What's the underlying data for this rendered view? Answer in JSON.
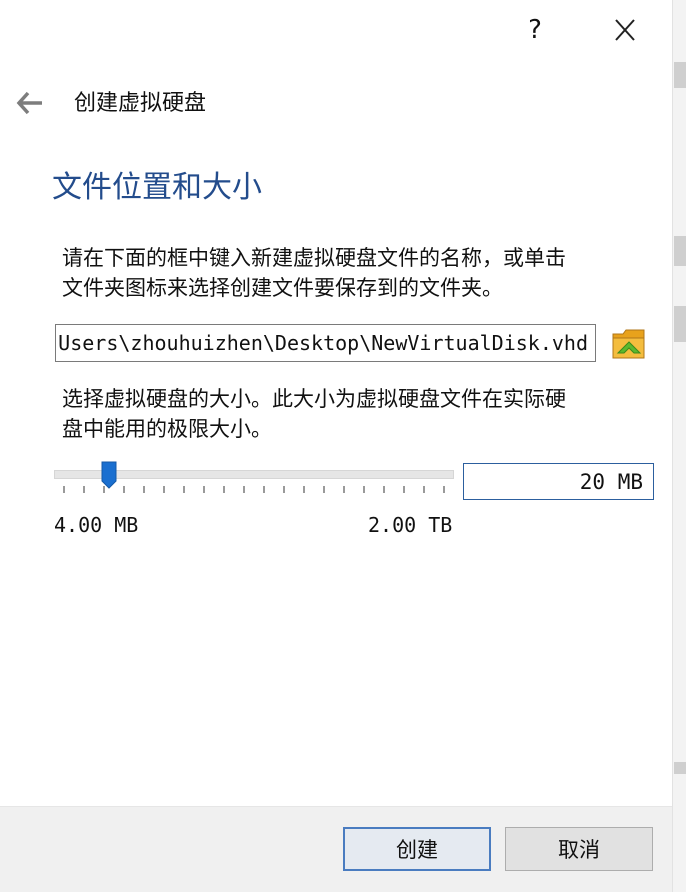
{
  "window": {
    "help_label": "?",
    "close_icon": "close-icon"
  },
  "header": {
    "back_icon": "back-arrow-icon",
    "title": "创建虚拟硬盘"
  },
  "section": {
    "title": "文件位置和大小"
  },
  "location": {
    "description_line1": "请在下面的框中键入新建虚拟硬盘文件的名称，或单击",
    "description_line2": "文件夹图标来选择创建文件要保存到的文件夹。",
    "file_path": "C:\\Users\\zhouhuizhen\\Desktop\\NewVirtualDisk.vhd",
    "folder_icon": "folder-icon"
  },
  "size": {
    "description_line1": "选择虚拟硬盘的大小。此大小为虚拟硬盘文件在实际硬",
    "description_line2": "盘中能用的极限大小。",
    "value": "20 MB",
    "min_label": "4.00 MB",
    "max_label": "2.00 TB"
  },
  "footer": {
    "create_label": "创建",
    "cancel_label": "取消"
  },
  "colors": {
    "title_blue": "#234c8c",
    "accent": "#1a6fd0",
    "footer_bg": "#f0f0f0"
  }
}
